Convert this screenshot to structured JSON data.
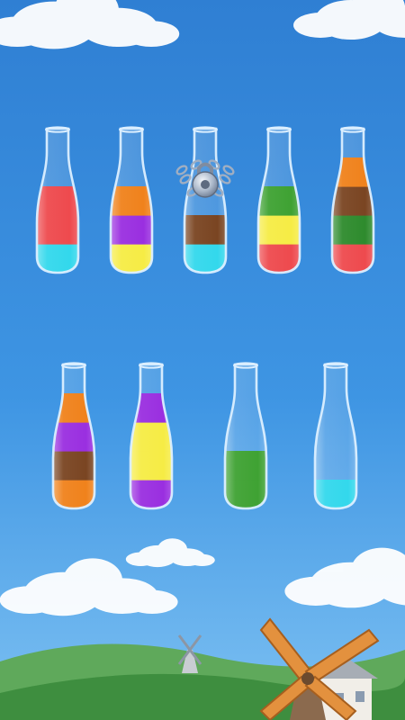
{
  "palette": {
    "sky_top": "#2F7FD3",
    "sky_mid": "#3E95E3",
    "sky_bottom": "#7CC0F2",
    "cloud": "#FFFFFF",
    "hill_far": "#5FA95B",
    "hill_near": "#3E8E3F",
    "glass_outline": "#DCEFFF"
  },
  "liquid_colors": {
    "red": "#EE4A4E",
    "cyan": "#33D8EC",
    "orange": "#F0821C",
    "purple": "#9A2FE0",
    "yellow": "#F6EC45",
    "brown": "#7A4522",
    "green": "#3FA233",
    "dark_green": "#2E8B2D"
  },
  "bottles": [
    {
      "layers": [
        "cyan",
        "red",
        "red"
      ],
      "locked": false
    },
    {
      "layers": [
        "yellow",
        "purple",
        "orange"
      ],
      "locked": false
    },
    {
      "layers": [
        "cyan",
        "brown"
      ],
      "locked": true,
      "lock_icon": "padlock-with-chains-icon"
    },
    {
      "layers": [
        "red",
        "yellow",
        "green"
      ],
      "locked": false
    },
    {
      "layers": [
        "red",
        "dark_green",
        "brown",
        "orange"
      ],
      "locked": false
    },
    {
      "layers": [
        "orange",
        "brown",
        "purple",
        "orange"
      ],
      "locked": false
    },
    {
      "layers": [
        "purple",
        "yellow",
        "yellow",
        "purple"
      ],
      "locked": false
    },
    {
      "layers": [
        "green",
        "green"
      ],
      "locked": false
    },
    {
      "layers": [
        "cyan"
      ],
      "locked": false
    }
  ],
  "background_objects": [
    "cloud",
    "cloud",
    "cloud",
    "cloud",
    "hills",
    "windmill",
    "windmill",
    "cottage"
  ]
}
